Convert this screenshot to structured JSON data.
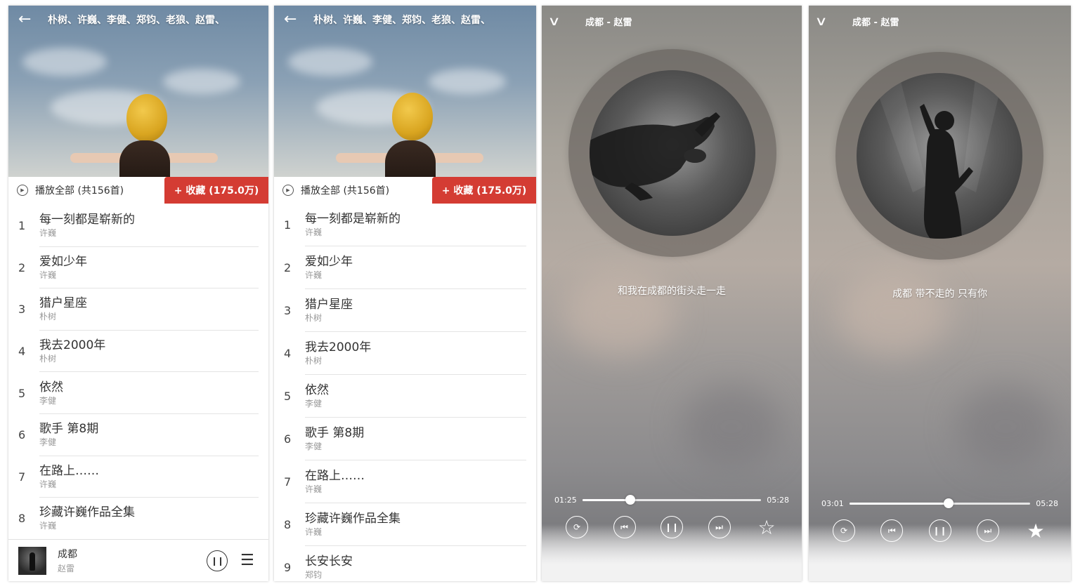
{
  "playlist": {
    "title": "朴树、许巍、李健、郑钧、老狼、赵雷、",
    "play_all_label": "播放全部 (共156首)",
    "collect_label": "+ 收藏 (175.0万)"
  },
  "songs": [
    {
      "index": "1",
      "name": "每一刻都是崭新的",
      "artist": "许巍"
    },
    {
      "index": "2",
      "name": "爱如少年",
      "artist": "许巍"
    },
    {
      "index": "3",
      "name": "猎户星座",
      "artist": "朴树"
    },
    {
      "index": "4",
      "name": "我去2000年",
      "artist": "朴树"
    },
    {
      "index": "5",
      "name": "依然",
      "artist": "李健"
    },
    {
      "index": "6",
      "name": "歌手 第8期",
      "artist": "李健"
    },
    {
      "index": "7",
      "name": "在路上……",
      "artist": "许巍"
    },
    {
      "index": "8",
      "name": "珍藏许巍作品全集",
      "artist": "许巍"
    },
    {
      "index": "9",
      "name": "长安长安",
      "artist": "郑钧"
    }
  ],
  "mini_player": {
    "title": "成都",
    "artist": "赵雷"
  },
  "player1": {
    "title": "成都 - 赵雷",
    "lyric": "和我在成都的街头走一走",
    "current_time": "01:25",
    "total_time": "05:28",
    "progress": 0.27,
    "favorited": false
  },
  "player2": {
    "title": "成都 - 赵雷",
    "lyric": "成都 带不走的 只有你",
    "current_time": "03:01",
    "total_time": "05:28",
    "progress": 0.55,
    "favorited": true
  },
  "colors": {
    "accent": "#d43c33"
  }
}
